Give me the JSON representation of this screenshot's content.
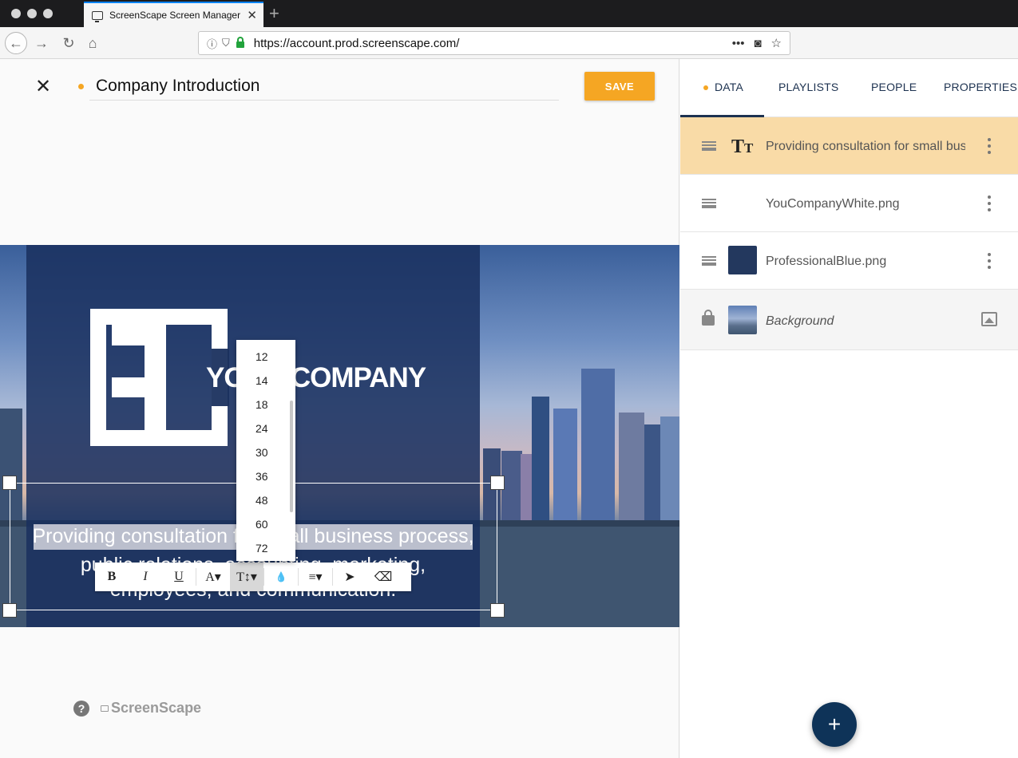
{
  "browser": {
    "tab_title": "ScreenScape Screen Manager",
    "url": "https://account.prod.screenscape.com/",
    "new_tab_label": "+"
  },
  "editor": {
    "close_label": "✕",
    "title": "Company Introduction",
    "save_label": "SAVE",
    "logo_text": "YOUR COMPANY",
    "text_lines": [
      "Providing consultation for small business process,",
      "public relations, accounting, marketing,",
      "employees, and communication."
    ],
    "format_toolbar": [
      "B",
      "I",
      "U",
      "A▾",
      "T↕▾",
      "💧",
      "≡▾",
      "➤",
      "⌫"
    ],
    "font_sizes": [
      "12",
      "14",
      "18",
      "24",
      "30",
      "36",
      "48",
      "60",
      "72"
    ],
    "brand": "ScreenScape",
    "help_label": "?"
  },
  "panel": {
    "tabs": [
      "DATA",
      "PLAYLISTS",
      "PEOPLE",
      "PROPERTIES"
    ],
    "active_tab": "DATA",
    "items": [
      {
        "label": "Providing consultation for small business",
        "icon": "text-size-icon",
        "selected": true
      },
      {
        "label": "YouCompanyWhite.png",
        "icon": "none",
        "selected": false
      },
      {
        "label": "ProfessionalBlue.png",
        "icon": "color-swatch",
        "selected": false
      },
      {
        "label": "Background",
        "icon": "image-thumbnail",
        "locked": true
      }
    ],
    "fab_label": "+"
  },
  "colors": {
    "accent": "#f5a623",
    "navy": "#1d3250",
    "panel_blue": "#1a305e",
    "selected_row": "#f9dba7",
    "fab": "#0e3358"
  }
}
